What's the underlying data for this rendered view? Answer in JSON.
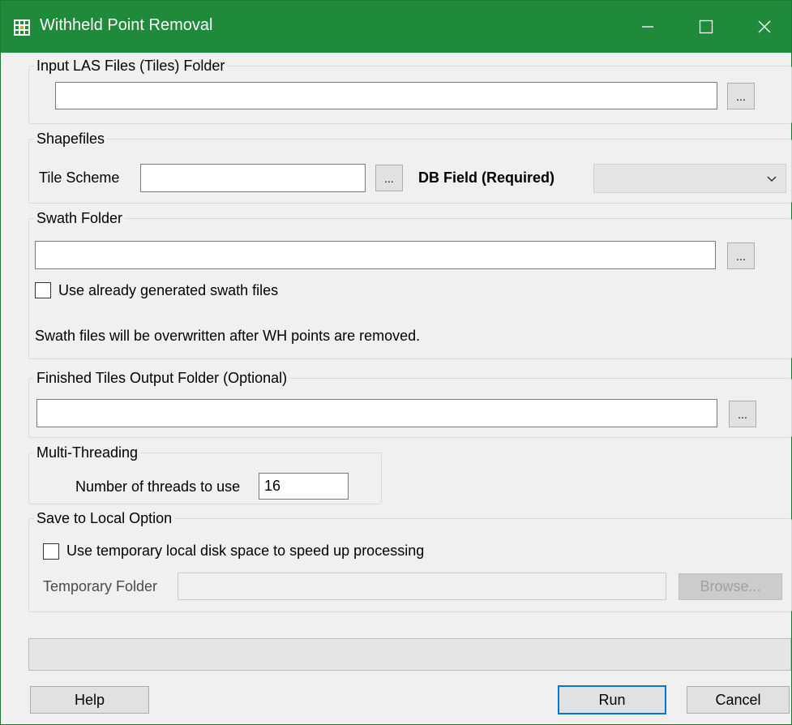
{
  "window": {
    "title": "Withheld Point Removal",
    "accent_color": "#1e8a3a",
    "icons": [
      "app-grid-icon",
      "minimize-icon",
      "maximize-icon",
      "close-icon"
    ]
  },
  "input_las": {
    "legend": "Input LAS Files (Tiles) Folder",
    "value": "",
    "browse_label": "..."
  },
  "shapefiles": {
    "legend": "Shapefiles",
    "tile_scheme_label": "Tile Scheme",
    "tile_scheme_value": "",
    "browse_label": "...",
    "db_field_label": "DB Field (Required)",
    "db_field_value": ""
  },
  "swath": {
    "legend": "Swath Folder",
    "value": "",
    "browse_label": "...",
    "checkbox_label": "Use already generated swath files",
    "checked": false,
    "note": "Swath files will be overwritten after WH points are removed."
  },
  "finished_tiles": {
    "legend": "Finished Tiles Output Folder (Optional)",
    "value": "",
    "browse_label": "..."
  },
  "multithreading": {
    "legend": "Multi-Threading",
    "threads_label": "Number of threads to use",
    "threads_value": "16"
  },
  "save_local": {
    "legend": "Save to Local Option",
    "checkbox_label": "Use temporary local disk space to speed up processing",
    "checked": false,
    "temp_folder_label": "Temporary Folder",
    "temp_folder_value": "",
    "browse_label": "Browse..."
  },
  "footer": {
    "status_text": "",
    "help_label": "Help",
    "run_label": "Run",
    "cancel_label": "Cancel"
  }
}
